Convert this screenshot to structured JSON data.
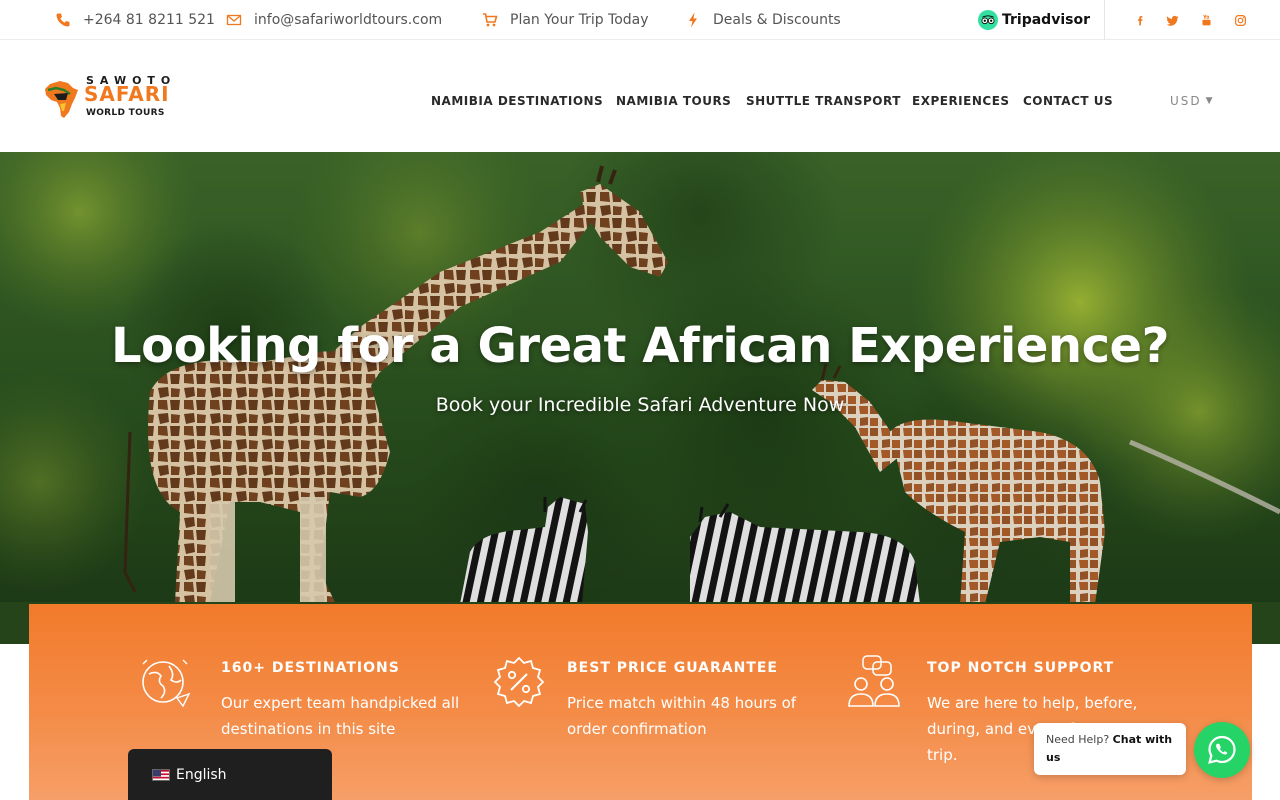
{
  "topbar": {
    "phone": "+264 81 8211 521",
    "email": "info@safariworldtours.com",
    "plan": "Plan Your Trip Today",
    "deals": "Deals & Discounts",
    "tripadvisor": "Tripadvisor",
    "icons": [
      "phone-icon",
      "envelope-icon",
      "cart-icon",
      "bolt-icon"
    ],
    "social": [
      "facebook-icon",
      "twitter-icon",
      "youtube-icon",
      "instagram-icon"
    ]
  },
  "header": {
    "logo": {
      "top": "SAWOTO",
      "middle": "SAFARI",
      "bottom": "WORLD TOURS"
    },
    "nav": [
      "NAMIBIA DESTINATIONS",
      "NAMIBIA TOURS",
      "SHUTTLE TRANSPORT",
      "EXPERIENCES",
      "CONTACT US"
    ],
    "currency": "USD"
  },
  "hero": {
    "title": "Looking for a Great African Experience?",
    "subtitle": "Book your Incredible Safari Adventure Now"
  },
  "features": [
    {
      "icon": "globe-icon",
      "title": "160+ DESTINATIONS",
      "text": "Our expert team handpicked all destinations in this site"
    },
    {
      "icon": "percent-badge-icon",
      "title": "BEST PRICE GUARANTEE",
      "text": "Price match within 48 hours of order confirmation"
    },
    {
      "icon": "support-people-icon",
      "title": "TOP NOTCH SUPPORT",
      "text": "We are here to help, before, during, and even after your trip."
    }
  ],
  "language": {
    "label": "English",
    "flag": "us-flag-icon"
  },
  "chat": {
    "prefix": "Need Help?",
    "bold": "Chat with us"
  },
  "colors": {
    "accent": "#f0791f",
    "band": "#f27a2b",
    "whatsapp": "#25d366",
    "dark": "#1f1f1f"
  }
}
